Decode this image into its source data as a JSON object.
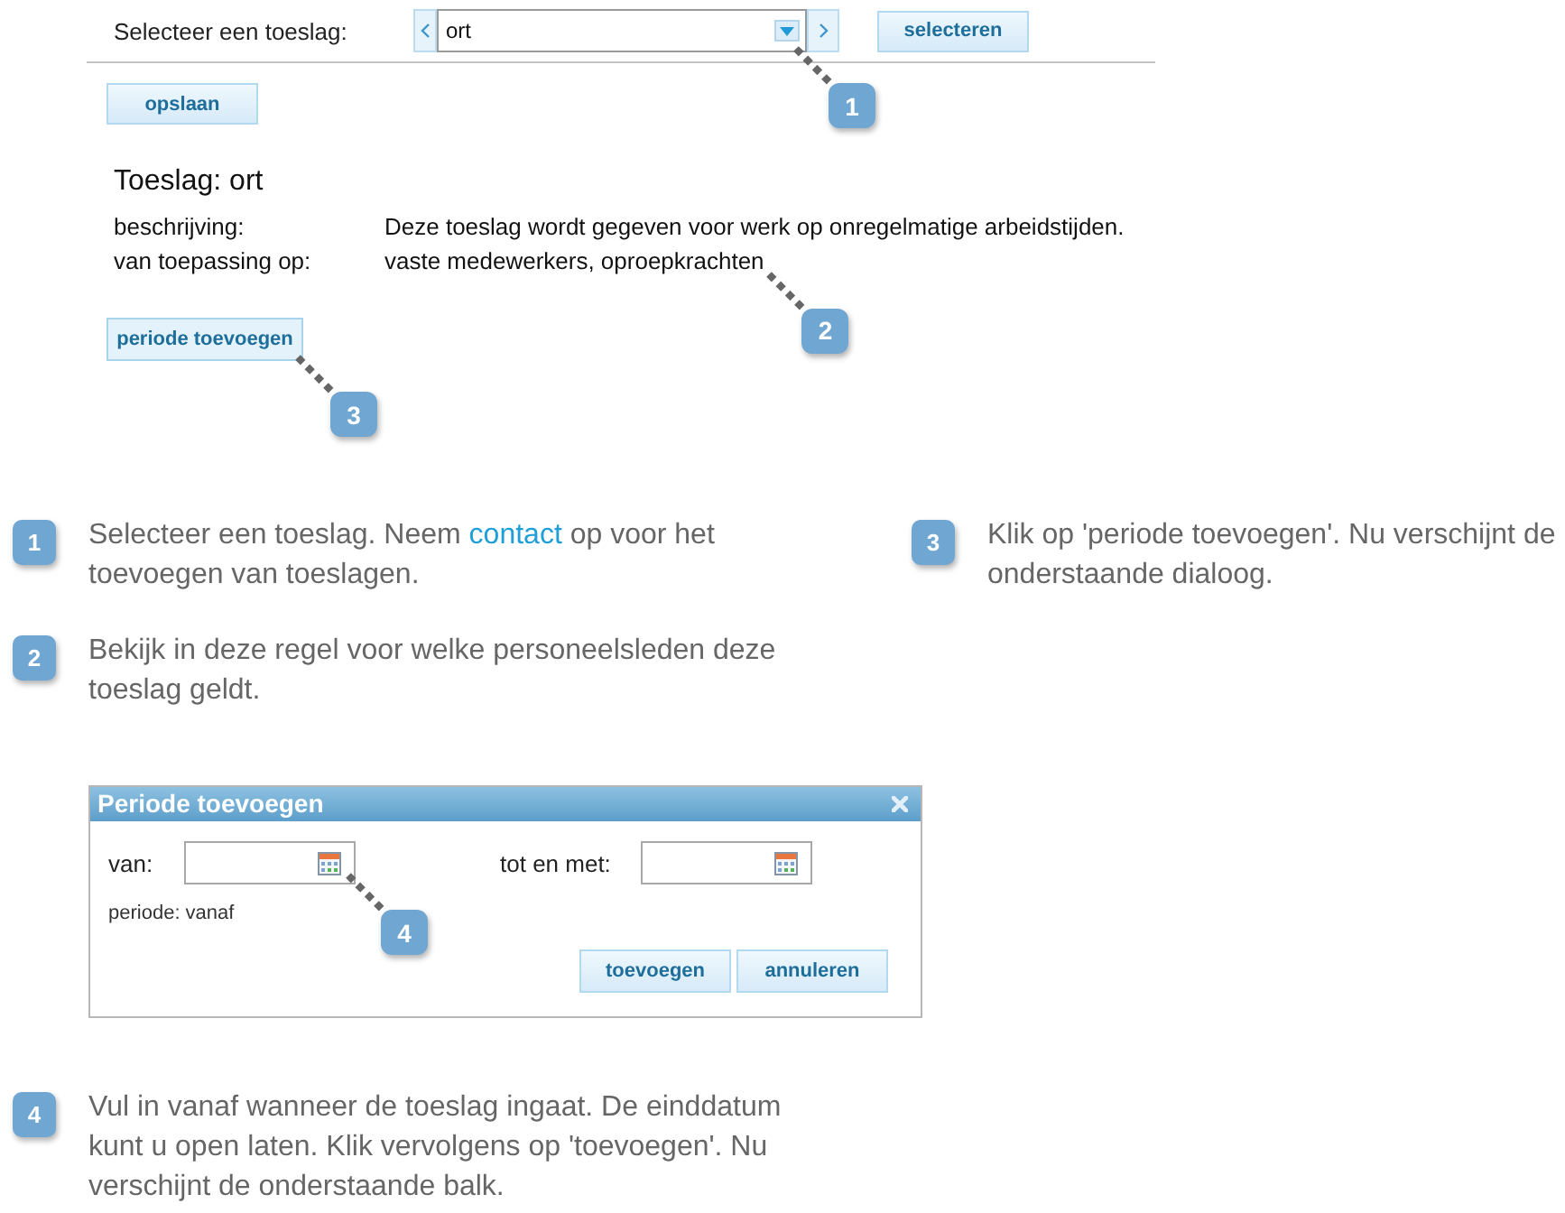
{
  "screenshot": {
    "selector": {
      "label": "Selecteer een toeslag:",
      "value": "ort",
      "callout": "1",
      "submit": "selecteren"
    },
    "save_button": "opslaan",
    "heading": "Toeslag: ort",
    "details": [
      {
        "label": "beschrijving:",
        "value": "Deze toeslag wordt gegeven voor werk op onregelmatige arbeidstijden."
      },
      {
        "label": "van toepassing op:",
        "value": "vaste medewerkers, oproepkrachten",
        "callout": "2"
      }
    ],
    "add_period_button": {
      "label": "periode toevoegen",
      "callout": "3"
    }
  },
  "step_columns": [
    [
      {
        "number": "1",
        "text": "Selecteer een toeslag. Neem ",
        "link": "contact",
        "text_after": " op voor het toevoegen van toeslagen."
      },
      {
        "number": "2",
        "text": "Bekijk in deze regel voor welke personeelsleden deze toeslag geldt."
      }
    ],
    [
      {
        "number": "3",
        "text": "Klik op 'periode toevoegen'. Nu verschijnt de onderstaande dialoog."
      }
    ]
  ],
  "dialog": {
    "title": "Periode toevoegen",
    "fields": [
      {
        "label": "van:",
        "callout": "4"
      },
      {
        "label": "tot en met:"
      }
    ],
    "note": "periode: vanaf",
    "buttons": [
      "toevoegen",
      "annuleren"
    ]
  },
  "final_step": {
    "number": "4",
    "text": "Vul in vanaf wanneer de toeslag ingaat. De einddatum kunt u open laten. Klik vervolgens op 'toevoegen'. Nu verschijnt de onderstaande balk."
  }
}
